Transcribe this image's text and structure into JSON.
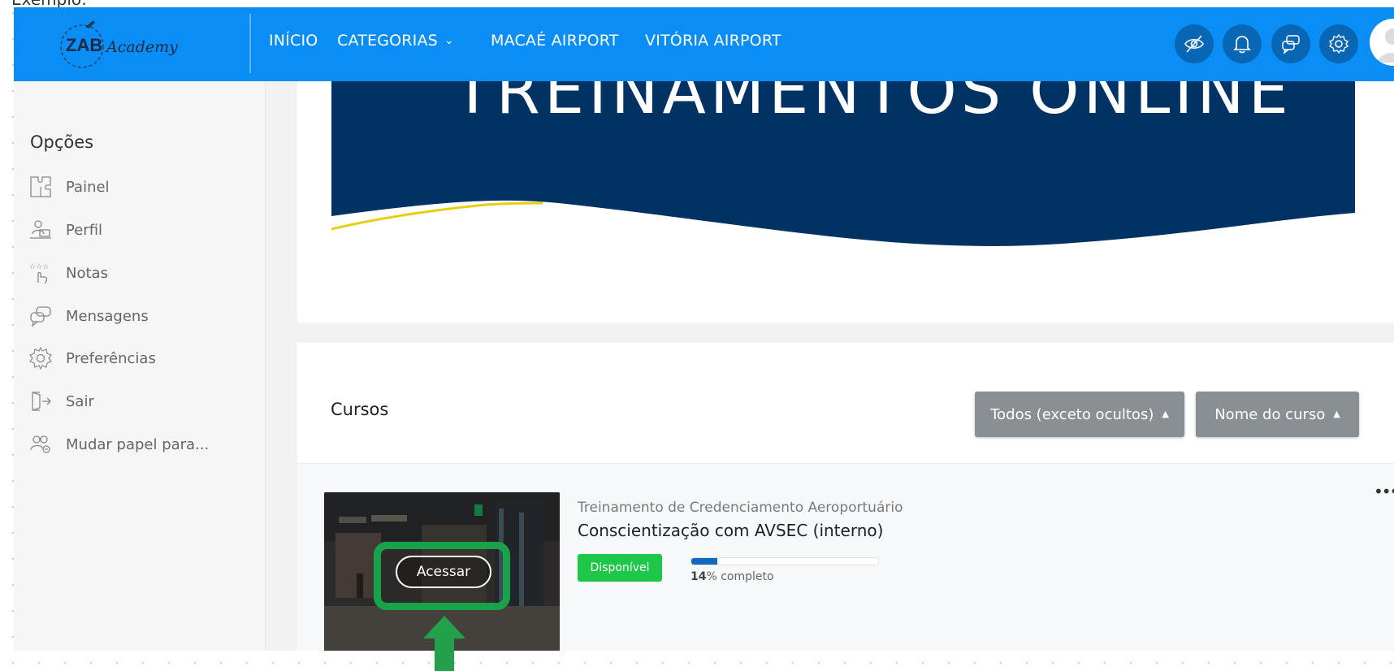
{
  "caption": "Exemplo:",
  "brand": {
    "logo_main": "ZAB",
    "logo_script": "Academy",
    "nav_color": "#0a8ef5"
  },
  "nav": {
    "links": [
      {
        "label": "INÍCIO"
      },
      {
        "label": "CATEGORIAS"
      },
      {
        "label": "MACAÉ AIRPORT"
      },
      {
        "label": "VITÓRIA AIRPORT"
      }
    ],
    "buttons": [
      {
        "icon": "eye-slash-icon"
      },
      {
        "icon": "bell-icon"
      },
      {
        "icon": "chat-icon"
      },
      {
        "icon": "gear-icon"
      }
    ]
  },
  "sidebar": {
    "title": "Opções",
    "items": [
      {
        "label": "Painel",
        "icon": "puzzle-icon"
      },
      {
        "label": "Perfil",
        "icon": "profile-desk-icon"
      },
      {
        "label": "Notas",
        "icon": "stars-hand-icon"
      },
      {
        "label": "Mensagens",
        "icon": "chat-icon"
      },
      {
        "label": "Preferências",
        "icon": "gear-icon"
      },
      {
        "label": "Sair",
        "icon": "logout-icon"
      },
      {
        "label": "Mudar papel para...",
        "icon": "users-icon"
      }
    ]
  },
  "banner": {
    "text": "TREINAMENTOS ONLINE",
    "bg_color": "#003263"
  },
  "courses": {
    "title": "Cursos",
    "filter_label": "Todos (exceto ocultos)",
    "sort_label": "Nome do curso",
    "items": [
      {
        "category": "Treinamento de Credenciamento Aeroportuário",
        "name": "Conscientização com AVSEC (interno)",
        "status": "Disponível",
        "progress_value": "14",
        "progress_suffix": "% completo",
        "progress_fraction": 0.14,
        "access_label": "Acessar"
      }
    ]
  }
}
